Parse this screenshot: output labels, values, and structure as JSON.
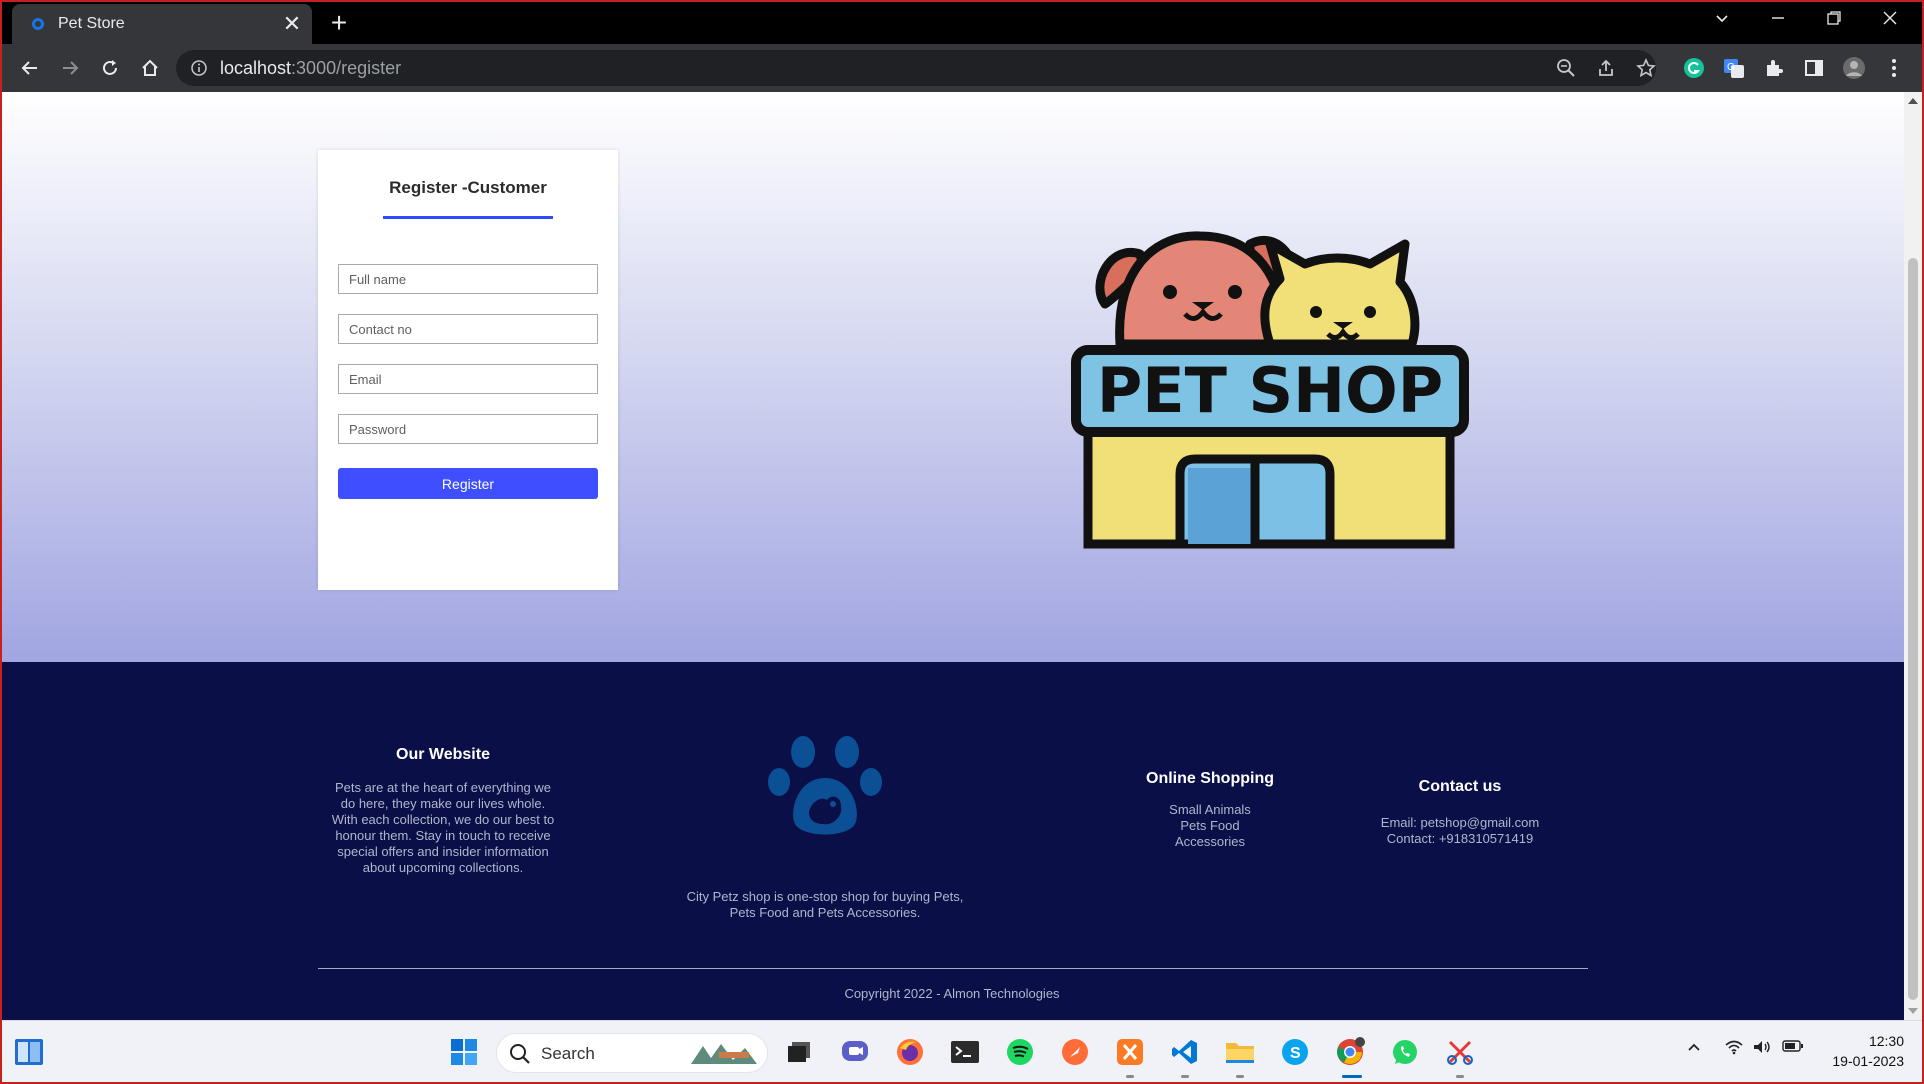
{
  "browser": {
    "tab_title": "Pet Store",
    "tab_close": "✕",
    "new_tab": "+",
    "url_host": "localhost",
    "url_path": ":3000/register"
  },
  "register": {
    "title": "Register -Customer",
    "placeholders": {
      "full_name": "Full name",
      "contact": "Contact no",
      "email": "Email",
      "password": "Password"
    },
    "button": "Register"
  },
  "logo": {
    "text": "PET SHOP"
  },
  "footer": {
    "website": {
      "heading": "Our Website",
      "lines": [
        "Pets are at the heart of everything we",
        "do here, they make our lives whole.",
        "With each collection, we do our best to",
        "honour them. Stay in touch to receive",
        "special offers and insider information",
        "about upcoming collections."
      ]
    },
    "about": {
      "lines": [
        "City Petz shop is one-stop shop for buying Pets,",
        "Pets Food and Pets Accessories."
      ]
    },
    "shopping": {
      "heading": "Online Shopping",
      "items": [
        "Small Animals",
        "Pets Food",
        "Accessories"
      ]
    },
    "contact": {
      "heading": "Contact us",
      "email": "Email: petshop@gmail.com",
      "phone": "Contact: +918310571419"
    },
    "copyright": "Copyright 2022 - Almon Technologies"
  },
  "taskbar": {
    "search_label": "Search",
    "time": "12:30",
    "date": "19-01-2023"
  },
  "colors": {
    "accent": "#3e4fff",
    "footer_bg": "#0a0f47",
    "paw": "#0b4f94"
  }
}
